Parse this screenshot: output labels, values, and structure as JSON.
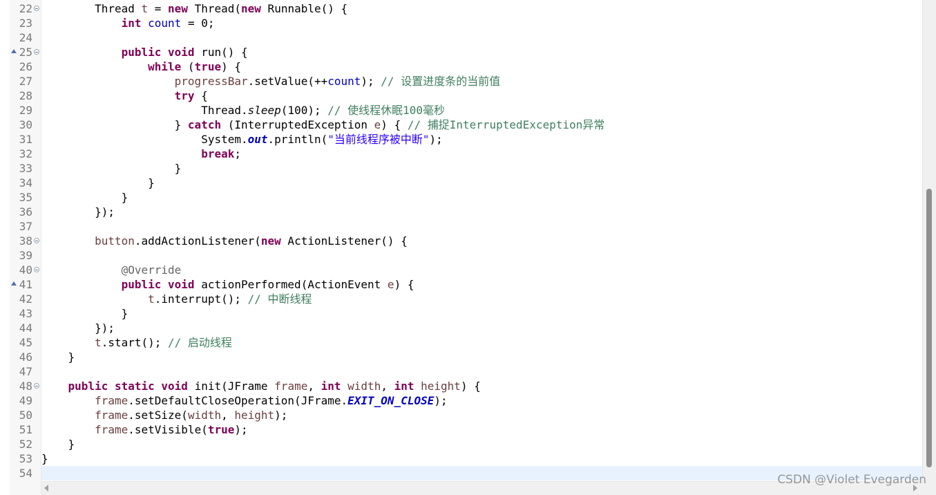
{
  "lines": [
    {
      "num": "22",
      "fold": true,
      "override": false,
      "current": false,
      "tokens": [
        {
          "t": "        Thread ",
          "c": "plain"
        },
        {
          "t": "t",
          "c": "var"
        },
        {
          "t": " = ",
          "c": "plain"
        },
        {
          "t": "new",
          "c": "kw"
        },
        {
          "t": " Thread(",
          "c": "plain"
        },
        {
          "t": "new",
          "c": "kw"
        },
        {
          "t": " Runnable() {",
          "c": "plain"
        }
      ]
    },
    {
      "num": "23",
      "fold": false,
      "override": false,
      "current": false,
      "tokens": [
        {
          "t": "            ",
          "c": "plain"
        },
        {
          "t": "int",
          "c": "kw"
        },
        {
          "t": " ",
          "c": "plain"
        },
        {
          "t": "count",
          "c": "fld"
        },
        {
          "t": " = 0;",
          "c": "plain"
        }
      ]
    },
    {
      "num": "24",
      "fold": false,
      "override": false,
      "current": false,
      "tokens": []
    },
    {
      "num": "25",
      "fold": true,
      "override": true,
      "current": false,
      "tokens": [
        {
          "t": "            ",
          "c": "plain"
        },
        {
          "t": "public",
          "c": "kw"
        },
        {
          "t": " ",
          "c": "plain"
        },
        {
          "t": "void",
          "c": "kw"
        },
        {
          "t": " run() {",
          "c": "plain"
        }
      ]
    },
    {
      "num": "26",
      "fold": false,
      "override": false,
      "current": false,
      "tokens": [
        {
          "t": "                ",
          "c": "plain"
        },
        {
          "t": "while",
          "c": "kw"
        },
        {
          "t": " (",
          "c": "plain"
        },
        {
          "t": "true",
          "c": "kw"
        },
        {
          "t": ") {",
          "c": "plain"
        }
      ]
    },
    {
      "num": "27",
      "fold": false,
      "override": false,
      "current": false,
      "tokens": [
        {
          "t": "                    ",
          "c": "plain"
        },
        {
          "t": "progressBar",
          "c": "var"
        },
        {
          "t": ".setValue(++",
          "c": "plain"
        },
        {
          "t": "count",
          "c": "fld"
        },
        {
          "t": "); ",
          "c": "plain"
        },
        {
          "t": "// 设置进度条的当前值",
          "c": "cmt"
        }
      ]
    },
    {
      "num": "28",
      "fold": false,
      "override": false,
      "current": false,
      "tokens": [
        {
          "t": "                    ",
          "c": "plain"
        },
        {
          "t": "try",
          "c": "kw"
        },
        {
          "t": " {",
          "c": "plain"
        }
      ]
    },
    {
      "num": "29",
      "fold": false,
      "override": false,
      "current": false,
      "tokens": [
        {
          "t": "                        Thread.",
          "c": "plain"
        },
        {
          "t": "sleep",
          "c": "ital"
        },
        {
          "t": "(100); ",
          "c": "plain"
        },
        {
          "t": "// 使线程休眠100毫秒",
          "c": "cmt"
        }
      ]
    },
    {
      "num": "30",
      "fold": false,
      "override": false,
      "current": false,
      "tokens": [
        {
          "t": "                    } ",
          "c": "plain"
        },
        {
          "t": "catch",
          "c": "kw"
        },
        {
          "t": " (InterruptedException ",
          "c": "plain"
        },
        {
          "t": "e",
          "c": "var"
        },
        {
          "t": ") { ",
          "c": "plain"
        },
        {
          "t": "// 捕捉InterruptedException异常",
          "c": "cmt"
        }
      ]
    },
    {
      "num": "31",
      "fold": false,
      "override": false,
      "current": false,
      "tokens": [
        {
          "t": "                        System.",
          "c": "plain"
        },
        {
          "t": "out",
          "c": "fldconst"
        },
        {
          "t": ".println(",
          "c": "plain"
        },
        {
          "t": "\"当前线程序被中断\"",
          "c": "str"
        },
        {
          "t": ");",
          "c": "plain"
        }
      ]
    },
    {
      "num": "32",
      "fold": false,
      "override": false,
      "current": false,
      "tokens": [
        {
          "t": "                        ",
          "c": "plain"
        },
        {
          "t": "break",
          "c": "kw"
        },
        {
          "t": ";",
          "c": "plain"
        }
      ]
    },
    {
      "num": "33",
      "fold": false,
      "override": false,
      "current": false,
      "tokens": [
        {
          "t": "                    }",
          "c": "plain"
        }
      ]
    },
    {
      "num": "34",
      "fold": false,
      "override": false,
      "current": false,
      "tokens": [
        {
          "t": "                }",
          "c": "plain"
        }
      ]
    },
    {
      "num": "35",
      "fold": false,
      "override": false,
      "current": false,
      "tokens": [
        {
          "t": "            }",
          "c": "plain"
        }
      ]
    },
    {
      "num": "36",
      "fold": false,
      "override": false,
      "current": false,
      "tokens": [
        {
          "t": "        });",
          "c": "plain"
        }
      ]
    },
    {
      "num": "37",
      "fold": false,
      "override": false,
      "current": false,
      "tokens": []
    },
    {
      "num": "38",
      "fold": true,
      "override": false,
      "current": false,
      "tokens": [
        {
          "t": "        ",
          "c": "plain"
        },
        {
          "t": "button",
          "c": "var"
        },
        {
          "t": ".addActionListener(",
          "c": "plain"
        },
        {
          "t": "new",
          "c": "kw"
        },
        {
          "t": " ActionListener() {",
          "c": "plain"
        }
      ]
    },
    {
      "num": "39",
      "fold": false,
      "override": false,
      "current": false,
      "tokens": []
    },
    {
      "num": "40",
      "fold": true,
      "override": false,
      "current": false,
      "tokens": [
        {
          "t": "            ",
          "c": "plain"
        },
        {
          "t": "@Override",
          "c": "ann"
        }
      ]
    },
    {
      "num": "41",
      "fold": false,
      "override": true,
      "current": false,
      "tokens": [
        {
          "t": "            ",
          "c": "plain"
        },
        {
          "t": "public",
          "c": "kw"
        },
        {
          "t": " ",
          "c": "plain"
        },
        {
          "t": "void",
          "c": "kw"
        },
        {
          "t": " actionPerformed(ActionEvent ",
          "c": "plain"
        },
        {
          "t": "e",
          "c": "var"
        },
        {
          "t": ") {",
          "c": "plain"
        }
      ]
    },
    {
      "num": "42",
      "fold": false,
      "override": false,
      "current": false,
      "tokens": [
        {
          "t": "                ",
          "c": "plain"
        },
        {
          "t": "t",
          "c": "var"
        },
        {
          "t": ".interrupt(); ",
          "c": "plain"
        },
        {
          "t": "// 中断线程",
          "c": "cmt"
        }
      ]
    },
    {
      "num": "43",
      "fold": false,
      "override": false,
      "current": false,
      "tokens": [
        {
          "t": "            }",
          "c": "plain"
        }
      ]
    },
    {
      "num": "44",
      "fold": false,
      "override": false,
      "current": false,
      "tokens": [
        {
          "t": "        });",
          "c": "plain"
        }
      ]
    },
    {
      "num": "45",
      "fold": false,
      "override": false,
      "current": false,
      "tokens": [
        {
          "t": "        ",
          "c": "plain"
        },
        {
          "t": "t",
          "c": "var"
        },
        {
          "t": ".start(); ",
          "c": "plain"
        },
        {
          "t": "// 启动线程",
          "c": "cmt"
        }
      ]
    },
    {
      "num": "46",
      "fold": false,
      "override": false,
      "current": false,
      "tokens": [
        {
          "t": "    }",
          "c": "plain"
        }
      ]
    },
    {
      "num": "47",
      "fold": false,
      "override": false,
      "current": false,
      "tokens": []
    },
    {
      "num": "48",
      "fold": true,
      "override": false,
      "current": false,
      "tokens": [
        {
          "t": "    ",
          "c": "plain"
        },
        {
          "t": "public",
          "c": "kw"
        },
        {
          "t": " ",
          "c": "plain"
        },
        {
          "t": "static",
          "c": "kw"
        },
        {
          "t": " ",
          "c": "plain"
        },
        {
          "t": "void",
          "c": "kw"
        },
        {
          "t": " init(JFrame ",
          "c": "plain"
        },
        {
          "t": "frame",
          "c": "var"
        },
        {
          "t": ", ",
          "c": "plain"
        },
        {
          "t": "int",
          "c": "kw"
        },
        {
          "t": " ",
          "c": "plain"
        },
        {
          "t": "width",
          "c": "var"
        },
        {
          "t": ", ",
          "c": "plain"
        },
        {
          "t": "int",
          "c": "kw"
        },
        {
          "t": " ",
          "c": "plain"
        },
        {
          "t": "height",
          "c": "var"
        },
        {
          "t": ") {",
          "c": "plain"
        }
      ]
    },
    {
      "num": "49",
      "fold": false,
      "override": false,
      "current": false,
      "tokens": [
        {
          "t": "        ",
          "c": "plain"
        },
        {
          "t": "frame",
          "c": "var"
        },
        {
          "t": ".setDefaultCloseOperation(JFrame.",
          "c": "plain"
        },
        {
          "t": "EXIT_ON_CLOSE",
          "c": "fldconst"
        },
        {
          "t": ");",
          "c": "plain"
        }
      ]
    },
    {
      "num": "50",
      "fold": false,
      "override": false,
      "current": false,
      "tokens": [
        {
          "t": "        ",
          "c": "plain"
        },
        {
          "t": "frame",
          "c": "var"
        },
        {
          "t": ".setSize(",
          "c": "plain"
        },
        {
          "t": "width",
          "c": "var"
        },
        {
          "t": ", ",
          "c": "plain"
        },
        {
          "t": "height",
          "c": "var"
        },
        {
          "t": ");",
          "c": "plain"
        }
      ]
    },
    {
      "num": "51",
      "fold": false,
      "override": false,
      "current": false,
      "tokens": [
        {
          "t": "        ",
          "c": "plain"
        },
        {
          "t": "frame",
          "c": "var"
        },
        {
          "t": ".setVisible(",
          "c": "plain"
        },
        {
          "t": "true",
          "c": "kw"
        },
        {
          "t": ");",
          "c": "plain"
        }
      ]
    },
    {
      "num": "52",
      "fold": false,
      "override": false,
      "current": false,
      "tokens": [
        {
          "t": "    }",
          "c": "plain"
        }
      ]
    },
    {
      "num": "53",
      "fold": false,
      "override": false,
      "current": false,
      "tokens": [
        {
          "t": "}",
          "c": "plain"
        }
      ]
    },
    {
      "num": "54",
      "fold": false,
      "override": false,
      "current": true,
      "tokens": []
    }
  ],
  "watermark": "CSDN @Violet Evegarden",
  "colors": {
    "keyword": "#7f0055",
    "field": "#0000c0",
    "variable": "#6a3e3e",
    "comment": "#3f7f5f",
    "string": "#2a00ff",
    "annotation": "#646464",
    "current_line": "#e8f2fe"
  },
  "icons": {
    "fold": "fold-collapse-icon",
    "override": "override-marker-icon",
    "scroll_left": "scroll-left-arrow-icon",
    "scroll_right": "scroll-right-arrow-icon"
  }
}
